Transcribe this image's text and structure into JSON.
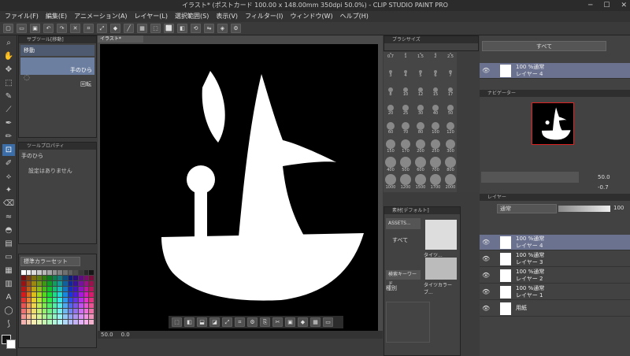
{
  "title": "イラスト* (ポストカード 100.00 x 148.00mm 350dpi 50.0%) - CLIP STUDIO PAINT PRO",
  "menu": [
    "ファイル(F)",
    "編集(E)",
    "アニメーション(A)",
    "レイヤー(L)",
    "選択範囲(S)",
    "表示(V)",
    "フィルター(I)",
    "ウィンドウ(W)",
    "ヘルプ(H)"
  ],
  "subtool": {
    "tab": "サブツール[移動]",
    "items": [
      "移動",
      "手のひら",
      "回転"
    ]
  },
  "toolprop": {
    "tab": "ツールプロパティ",
    "tool_name": "手のひら",
    "no_settings": "設定はありません"
  },
  "colorset": {
    "select": "標準カラーセット"
  },
  "canvas_tab": "イラスト*",
  "status": {
    "zoom": "50.0",
    "angle": "0.0"
  },
  "brushsize": {
    "tab": "ブラシサイズ",
    "sizes": [
      "0.7",
      "1",
      "1.5",
      "2",
      "2.5",
      "3",
      "4",
      "5",
      "6",
      "7",
      "8",
      "10",
      "12",
      "15",
      "17",
      "20",
      "25",
      "30",
      "40",
      "50",
      "60",
      "70",
      "80",
      "100",
      "120",
      "150",
      "170",
      "200",
      "250",
      "300",
      "400",
      "500",
      "600",
      "700",
      "800",
      "1000",
      "1200",
      "1500",
      "1700",
      "2000"
    ]
  },
  "material": {
    "tab": "素材[デフォルト]",
    "assets": "ASSETS...",
    "all": "すべて",
    "search": "検索キーワード",
    "kind": "種別",
    "thumb1": "タイツ...",
    "thumb2": "タイツカラーブ..."
  },
  "layer_search": {
    "select": "すべて"
  },
  "layer_thumb": {
    "mode": "100 %通常",
    "name": "レイヤー 4"
  },
  "navigator": {
    "tab": "ナビゲーター",
    "zoom": "50.0",
    "angle": "-0.7"
  },
  "layer_panel": {
    "tab": "レイヤー",
    "blend": "通常",
    "opacity": "100",
    "layers": [
      {
        "mode": "100 %通常",
        "name": "レイヤー 4"
      },
      {
        "mode": "100 %通常",
        "name": "レイヤー 3"
      },
      {
        "mode": "100 %通常",
        "name": "レイヤー 2"
      },
      {
        "mode": "100 %通常",
        "name": "レイヤー 1"
      },
      {
        "mode": "",
        "name": "用紙"
      }
    ]
  },
  "colors": {
    "accent": "#3b6ea8",
    "selected_layer": "#6a7290",
    "canvas_bg": "#000000",
    "drawing": "#ffffff"
  }
}
